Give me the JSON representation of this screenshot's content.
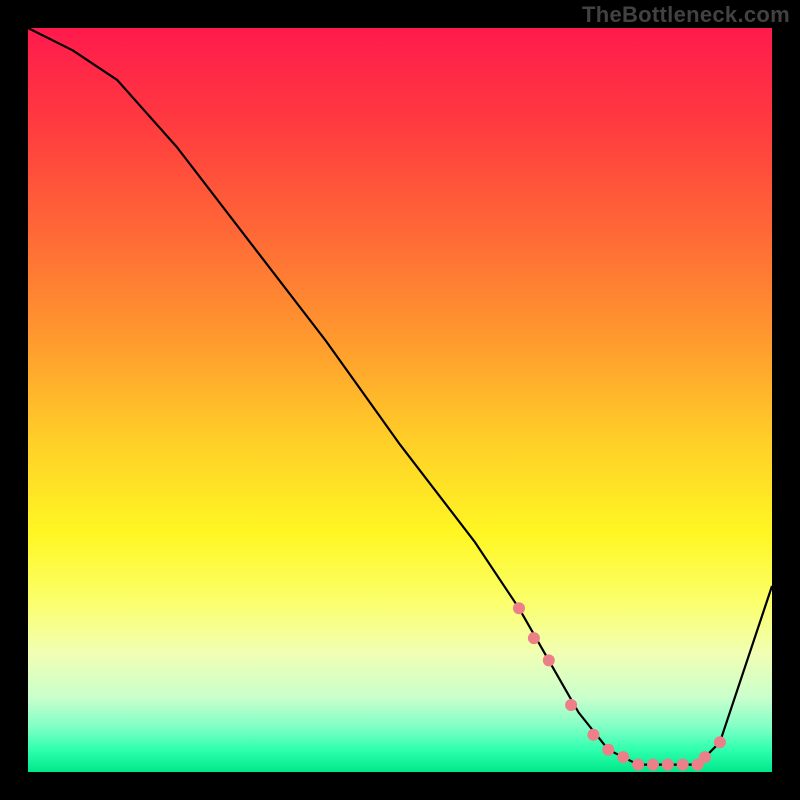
{
  "watermark": "TheBottleneck.com",
  "chart_data": {
    "type": "line",
    "title": "",
    "xlabel": "",
    "ylabel": "",
    "xlim": [
      0,
      100
    ],
    "ylim": [
      0,
      100
    ],
    "x": [
      0,
      6,
      12,
      20,
      30,
      40,
      50,
      60,
      66,
      70,
      74,
      78,
      82,
      86,
      90,
      93,
      100
    ],
    "values": [
      100,
      97,
      93,
      84,
      71,
      58,
      44,
      31,
      22,
      15,
      8,
      3,
      1,
      1,
      1,
      4,
      25
    ],
    "markers": {
      "x": [
        66,
        68,
        70,
        73,
        76,
        78,
        80,
        82,
        84,
        86,
        88,
        90,
        91,
        93
      ],
      "y": [
        22,
        18,
        15,
        9,
        5,
        3,
        2,
        1,
        1,
        1,
        1,
        1,
        2,
        4
      ],
      "color": "#ec7f88",
      "radius": 6
    },
    "line_color": "#000000",
    "line_width": 2.2,
    "gradient_stops": [
      {
        "pos": 0,
        "color": "#ff1a4d"
      },
      {
        "pos": 13,
        "color": "#ff3b3f"
      },
      {
        "pos": 28,
        "color": "#ff6a36"
      },
      {
        "pos": 42,
        "color": "#ff9a2e"
      },
      {
        "pos": 55,
        "color": "#ffcd28"
      },
      {
        "pos": 68,
        "color": "#fff723"
      },
      {
        "pos": 77,
        "color": "#fbff6a"
      },
      {
        "pos": 84,
        "color": "#f1ffb3"
      },
      {
        "pos": 90,
        "color": "#c9ffcd"
      },
      {
        "pos": 94,
        "color": "#7fffc6"
      },
      {
        "pos": 97,
        "color": "#2effae"
      },
      {
        "pos": 100,
        "color": "#00e98a"
      }
    ]
  }
}
